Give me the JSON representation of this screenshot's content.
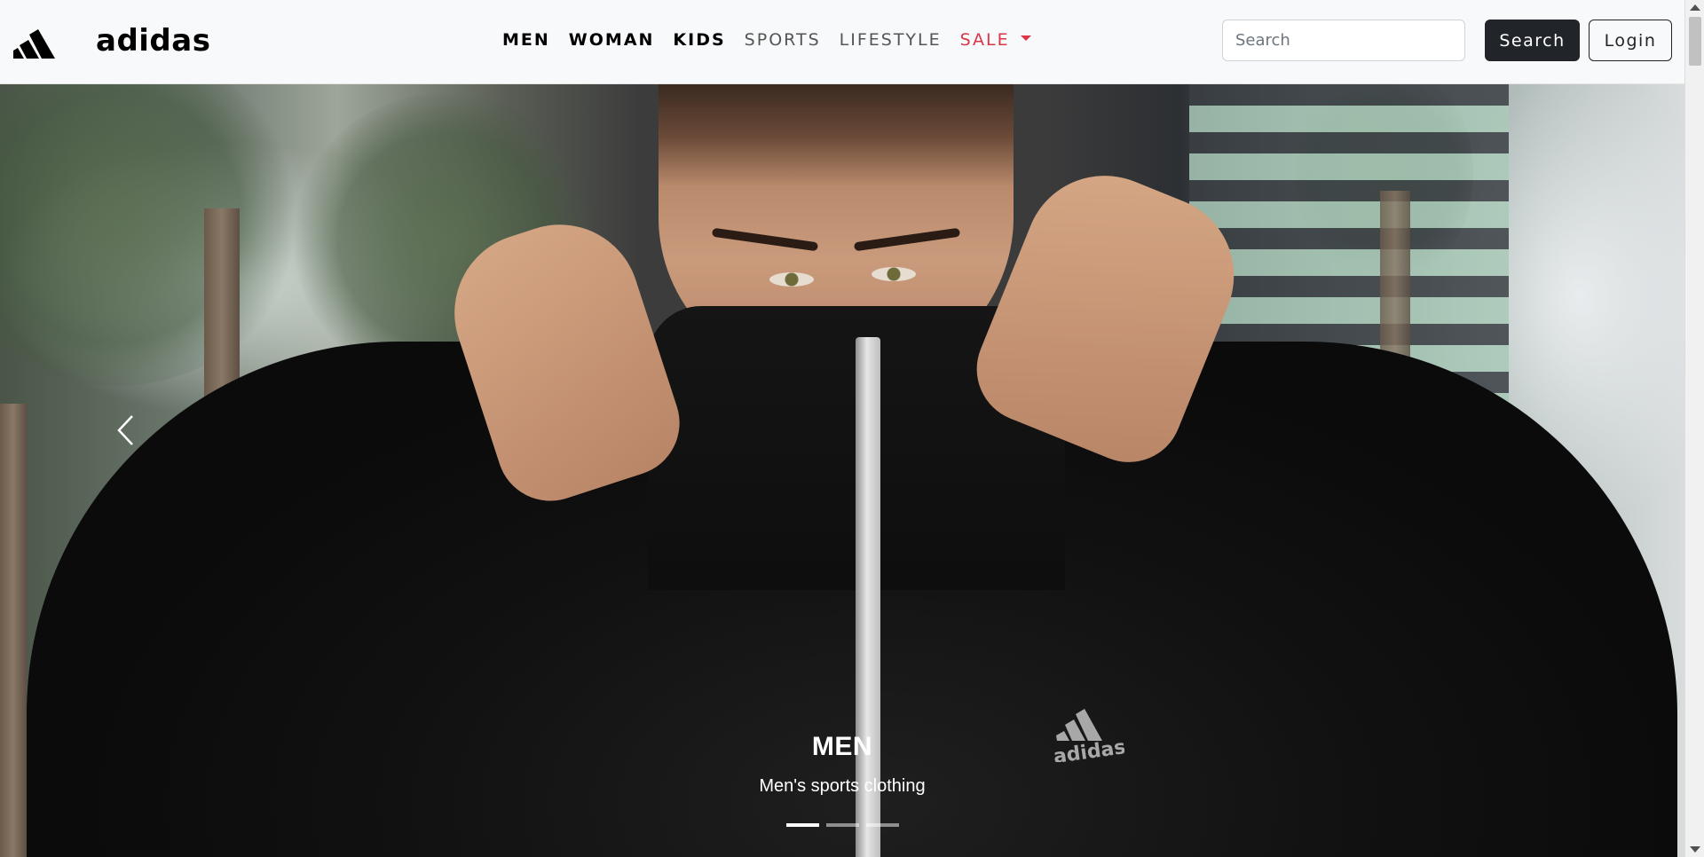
{
  "brand": {
    "name": "adidas"
  },
  "nav": {
    "items": [
      {
        "label": "MEN",
        "style": "bold"
      },
      {
        "label": "WOMAN",
        "style": "bold"
      },
      {
        "label": "KIDS",
        "style": "bold"
      },
      {
        "label": "SPORTS",
        "style": "muted"
      },
      {
        "label": "LIFESTYLE",
        "style": "muted"
      },
      {
        "label": "SALE",
        "style": "sale"
      }
    ]
  },
  "search": {
    "placeholder": "Search",
    "value": "",
    "button_label": "Search"
  },
  "login": {
    "label": "Login"
  },
  "carousel": {
    "title": "MEN",
    "subtitle": "Men's sports clothing",
    "slide_count": 3,
    "active_index": 0,
    "prev_icon": "chevron-left-icon"
  },
  "colors": {
    "navbar_bg": "#f8f9fa",
    "sale": "#dc3545",
    "dark_button": "#212529"
  }
}
